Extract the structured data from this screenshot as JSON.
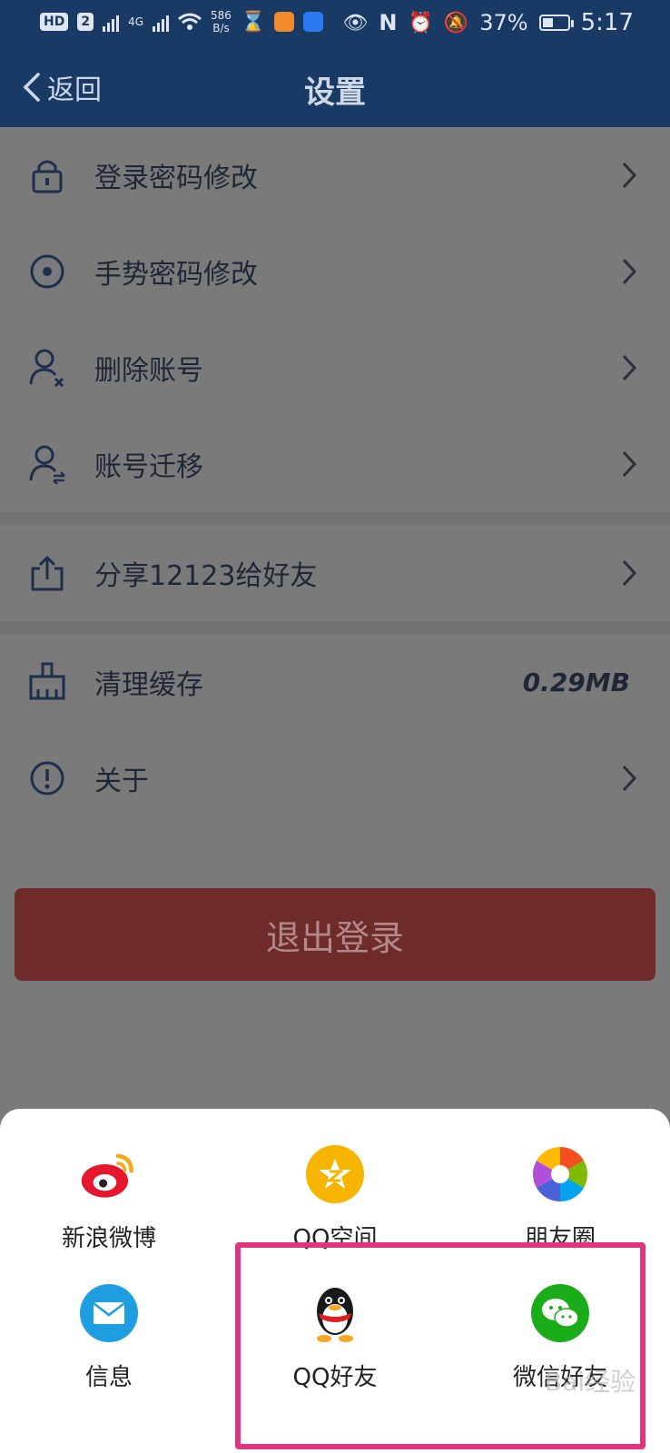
{
  "status_bar": {
    "network_speed": "586",
    "network_unit": "B/s",
    "sim_label_1": "HD",
    "sim_label_2": "2",
    "lte": "4G",
    "battery": "37%",
    "time": "5:17"
  },
  "header": {
    "back_label": "返回",
    "title": "设置"
  },
  "settings": [
    {
      "label": "登录密码修改",
      "icon": "lock-icon"
    },
    {
      "label": "手势密码修改",
      "icon": "target-icon"
    },
    {
      "label": "删除账号",
      "icon": "user-remove-icon"
    },
    {
      "label": "账号迁移",
      "icon": "user-transfer-icon"
    },
    {
      "label": "分享12123给好友",
      "icon": "share-icon"
    },
    {
      "label": "清理缓存",
      "icon": "broom-icon",
      "value": "0.29MB"
    },
    {
      "label": "关于",
      "icon": "info-icon"
    }
  ],
  "logout_label": "退出登录",
  "share_sheet": {
    "items": [
      {
        "label": "新浪微博",
        "icon": "weibo-icon"
      },
      {
        "label": "QQ空间",
        "icon": "qzone-icon"
      },
      {
        "label": "朋友圈",
        "icon": "moments-icon"
      },
      {
        "label": "信息",
        "icon": "message-icon"
      },
      {
        "label": "QQ好友",
        "icon": "qq-icon"
      },
      {
        "label": "微信好友",
        "icon": "wechat-icon"
      }
    ]
  },
  "colors": {
    "header_bg": "#1a3a66",
    "logout_bg": "#6f2a2a",
    "highlight": "#e0347e"
  },
  "watermark": "Bai经验"
}
